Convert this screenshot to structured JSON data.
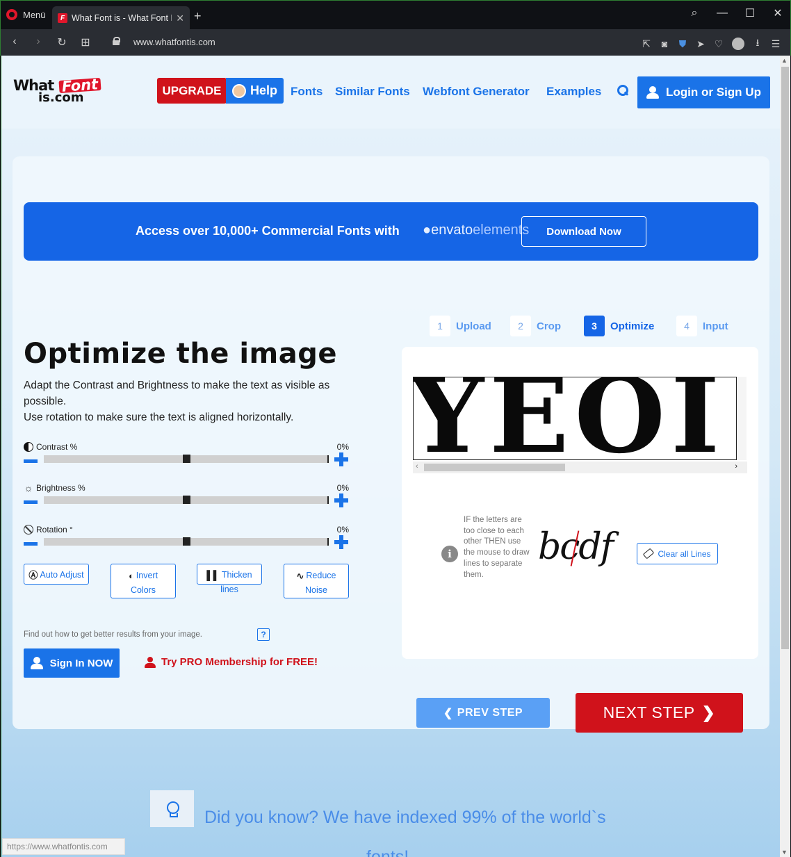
{
  "browser": {
    "menu_label": "Menü",
    "tab_title": "What Font is - What Font Is",
    "tab_favicon": "F",
    "url": "www.whatfontis.com",
    "status_url": "https://www.whatfontis.com"
  },
  "header": {
    "logo_what": "What",
    "logo_font": "Font",
    "logo_iscom": "is.com",
    "upgrade": "UPGRADE",
    "help": "Help",
    "nav": [
      "Fonts",
      "Similar Fonts",
      "Webfont Generator",
      "Examples"
    ],
    "login": "Login or Sign Up"
  },
  "banner": {
    "text_prefix": "Access over ",
    "text_bold": "10,000+",
    "text_suffix": " Commercial Fonts with ",
    "brand_a": "envato",
    "brand_b": "elements",
    "button": "Download Now"
  },
  "steps": [
    {
      "num": "1",
      "label": "Upload"
    },
    {
      "num": "2",
      "label": "Crop"
    },
    {
      "num": "3",
      "label": "Optimize"
    },
    {
      "num": "4",
      "label": "Input"
    }
  ],
  "optimize": {
    "title": "Optimize the image",
    "desc_1": "Adapt the Contrast and Brightness to make the text as visible as possible.",
    "desc_2": "Use rotation to make sure the text is aligned horizontally.",
    "sliders": [
      {
        "label": "Contrast %",
        "value": "0%",
        "icon": "contrast-icon"
      },
      {
        "label": "Brightness %",
        "value": "0%",
        "icon": "sun-icon"
      },
      {
        "label": "Rotation °",
        "value": "0%",
        "icon": "rotation-icon"
      }
    ],
    "tools": {
      "auto_adjust": "Auto Adjust",
      "invert_1": "Invert",
      "invert_2": "Colors",
      "thicken": "Thicken lines",
      "reduce_1": "Reduce",
      "reduce_2": "Noise"
    },
    "hint": "Find out how to get better results from your image.",
    "help_mark": "?",
    "signin": "Sign In NOW",
    "pro": "Try PRO Membership for FREE!"
  },
  "preview": {
    "image_text": "YEOI",
    "info_text": "IF the letters are too close to each other THEN use the mouse to draw lines to separate them.",
    "sample": "bcdf",
    "clear_button": "Clear all Lines"
  },
  "navigation": {
    "prev": "PREV STEP",
    "next": "NEXT STEP"
  },
  "did_you_know": {
    "line_1": "Did you know? We have indexed 99% of the world`s",
    "line_2": "fonts!"
  },
  "colors": {
    "accent": "#1a73e8",
    "brand_red": "#d0121b",
    "banner": "#1565e6"
  }
}
